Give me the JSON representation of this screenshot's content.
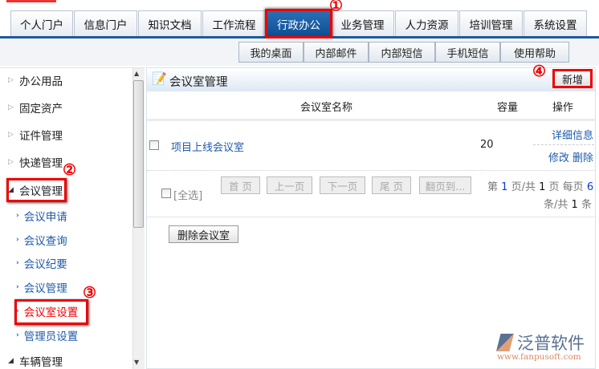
{
  "top_tabs": [
    "个人门户",
    "信息门户",
    "知识文档",
    "工作流程",
    "行政办公",
    "业务管理",
    "人力资源",
    "培训管理",
    "系统设置"
  ],
  "active_tab": "行政办公",
  "sub_tabs": [
    "我的桌面",
    "内部邮件",
    "内部短信",
    "手机短信",
    "使用帮助"
  ],
  "sidebar": {
    "groups": [
      "办公用品",
      "固定资产",
      "证件管理",
      "快递管理",
      "会议管理"
    ],
    "sub_items": [
      "会议申请",
      "会议查询",
      "会议纪要",
      "会议管理",
      "会议室设置",
      "管理员设置"
    ],
    "last_group": "车辆管理"
  },
  "annotations": [
    "①",
    "②",
    "③",
    "④"
  ],
  "main": {
    "title": "会议室管理",
    "add_button": "新增",
    "columns": [
      "会议室名称",
      "容量",
      "操作"
    ],
    "rows": [
      {
        "name": "项目上线会议室",
        "capacity": "20",
        "actions": [
          "详细信息",
          "修改",
          "删除"
        ]
      }
    ],
    "select_all": "[全选]",
    "pager": {
      "buttons": [
        "首 页",
        "上一页",
        "下一页",
        "尾 页",
        "翻页到..."
      ],
      "t1": "第",
      "page": "1",
      "t2": "页/共",
      "total_pages": "1",
      "t3": "页 每页",
      "per_page": "6",
      "t4": "条/共",
      "total": "1",
      "t5": "条"
    },
    "delete_button": "删除会议室"
  },
  "watermark": {
    "brand": "泛普软件",
    "url": "www.fanpusoft.com"
  }
}
